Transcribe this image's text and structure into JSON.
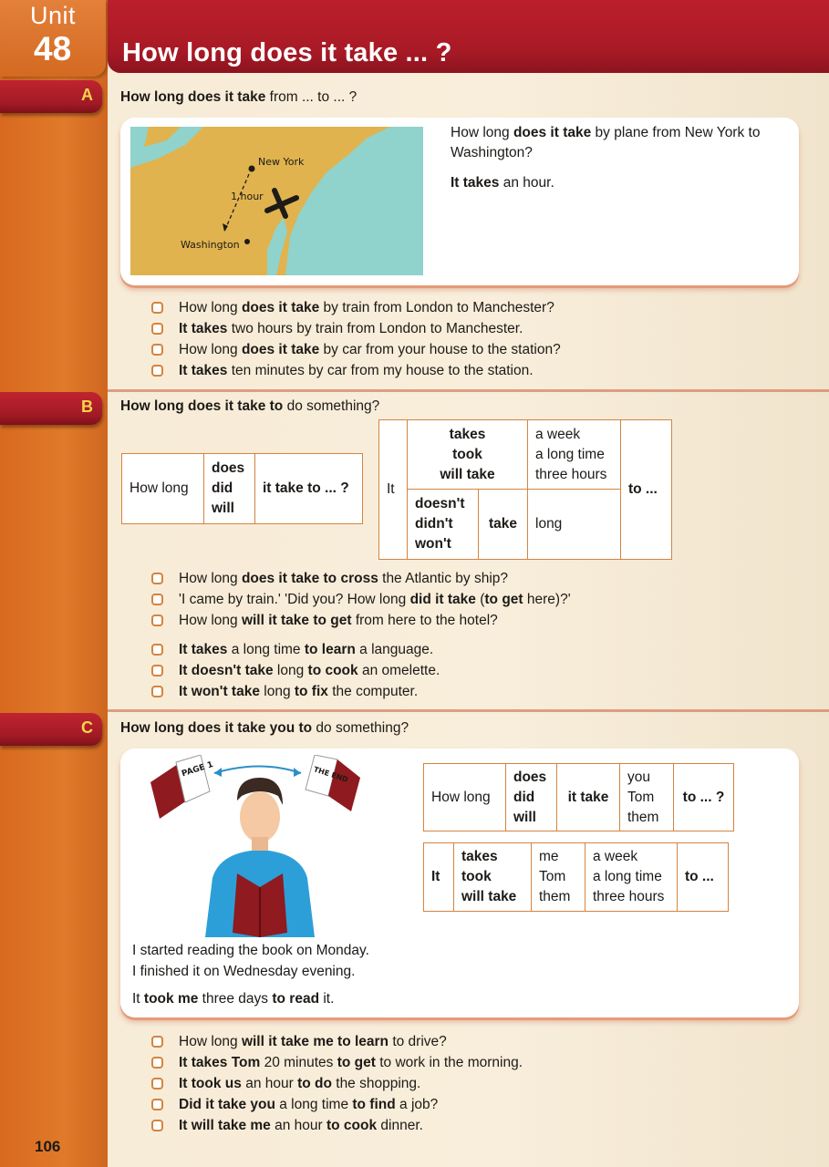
{
  "unit": {
    "label": "Unit",
    "number": "48"
  },
  "title": "How long does it take ... ?",
  "page_number": "106",
  "sections": {
    "A": {
      "letter": "A",
      "heading": {
        "bold": "How long does it take",
        "rest": " from ... to ... ?"
      },
      "map": {
        "labels": [
          "New York",
          "1 hour",
          "Washington"
        ]
      },
      "example": {
        "q_pre": "How long ",
        "q_bold": "does it take",
        "q_post": " by plane from New York to Washington?",
        "a_bold": "It takes",
        "a_post": " an hour."
      },
      "bullets": [
        {
          "pre": "How long ",
          "bold": "does it take",
          "post": " by train from London to Manchester?"
        },
        {
          "pre": "",
          "bold": "It takes",
          "post": " two hours by train from London to Manchester."
        },
        {
          "pre": "How long ",
          "bold": "does it take",
          "post": " by car from your house to the station?"
        },
        {
          "pre": "",
          "bold": "It takes",
          "post": " ten minutes by car from my house to the station."
        }
      ]
    },
    "B": {
      "letter": "B",
      "heading": {
        "bold": "How long does it take to",
        "rest": " do something?"
      },
      "table_question": {
        "c1": "How long",
        "c2": [
          "does",
          "did",
          "will"
        ],
        "c3": "it take to ... ?"
      },
      "table_answer": {
        "subject": "It",
        "pos_verbs": [
          "takes",
          "took",
          "will take"
        ],
        "pos_times": [
          "a week",
          "a long time",
          "three hours"
        ],
        "neg_aux": [
          "doesn't",
          "didn't",
          "won't"
        ],
        "neg_verb": "take",
        "neg_time": "long",
        "end": "to ..."
      },
      "bullets_group1": [
        {
          "segs": [
            [
              "How long ",
              0
            ],
            [
              "does it take to cross",
              1
            ],
            [
              " the Atlantic by ship?",
              0
            ]
          ]
        },
        {
          "segs": [
            [
              "'I came by train.'   'Did you?  How long ",
              0
            ],
            [
              "did it take",
              1
            ],
            [
              " (",
              0
            ],
            [
              "to get",
              1
            ],
            [
              " here)?'",
              0
            ]
          ]
        },
        {
          "segs": [
            [
              "How long ",
              0
            ],
            [
              "will it take to get",
              1
            ],
            [
              " from here to the hotel?",
              0
            ]
          ]
        }
      ],
      "bullets_group2": [
        {
          "segs": [
            [
              "It takes",
              1
            ],
            [
              " a long time ",
              0
            ],
            [
              "to learn",
              1
            ],
            [
              " a language.",
              0
            ]
          ]
        },
        {
          "segs": [
            [
              "It doesn't take",
              1
            ],
            [
              " long ",
              0
            ],
            [
              "to cook",
              1
            ],
            [
              " an omelette.",
              0
            ]
          ]
        },
        {
          "segs": [
            [
              "It won't take",
              1
            ],
            [
              " long ",
              0
            ],
            [
              "to fix",
              1
            ],
            [
              " the computer.",
              0
            ]
          ]
        }
      ]
    },
    "C": {
      "letter": "C",
      "heading": {
        "bold": "How long does it take you to",
        "rest": " do something?"
      },
      "illustration": {
        "book_start": "PAGE 1",
        "book_end": "THE END"
      },
      "story": {
        "line1": "I started reading the book on Monday.",
        "line2": "I finished it on Wednesday evening.",
        "line3_pre": "It ",
        "line3_b1": "took me",
        "line3_mid": " three days ",
        "line3_b2": "to read",
        "line3_post": " it."
      },
      "table_question": {
        "c1": "How long",
        "c2": [
          "does",
          "did",
          "will"
        ],
        "c3": "it take",
        "c4": [
          "you",
          "Tom",
          "them"
        ],
        "c5": "to ... ?"
      },
      "table_answer": {
        "c1": "It",
        "c2": [
          "takes",
          "took",
          "will take"
        ],
        "c3": [
          "me",
          "Tom",
          "them"
        ],
        "c4": [
          "a week",
          "a long time",
          "three hours"
        ],
        "c5": "to ..."
      },
      "bullets": [
        {
          "segs": [
            [
              "How long ",
              0
            ],
            [
              "will it take me to learn",
              1
            ],
            [
              " to drive?",
              0
            ]
          ]
        },
        {
          "segs": [
            [
              "It takes Tom",
              1
            ],
            [
              " 20 minutes ",
              0
            ],
            [
              "to get",
              1
            ],
            [
              " to work in the morning.",
              0
            ]
          ]
        },
        {
          "segs": [
            [
              "It took us",
              1
            ],
            [
              " an hour ",
              0
            ],
            [
              "to do",
              1
            ],
            [
              " the shopping.",
              0
            ]
          ]
        },
        {
          "segs": [
            [
              "Did it take you",
              1
            ],
            [
              " a long time ",
              0
            ],
            [
              "to find",
              1
            ],
            [
              " a job?",
              0
            ]
          ]
        },
        {
          "segs": [
            [
              "It will take me",
              1
            ],
            [
              " an hour ",
              0
            ],
            [
              "to cook",
              1
            ],
            [
              " dinner.",
              0
            ]
          ]
        }
      ]
    }
  },
  "colors": {
    "title_red": "#a81a25",
    "sidebar_orange": "#d8691f",
    "section_letter": "#f5d64a",
    "table_border": "#d4843f",
    "map_land": "#e0b34f",
    "map_sea": "#8fd3cc"
  }
}
